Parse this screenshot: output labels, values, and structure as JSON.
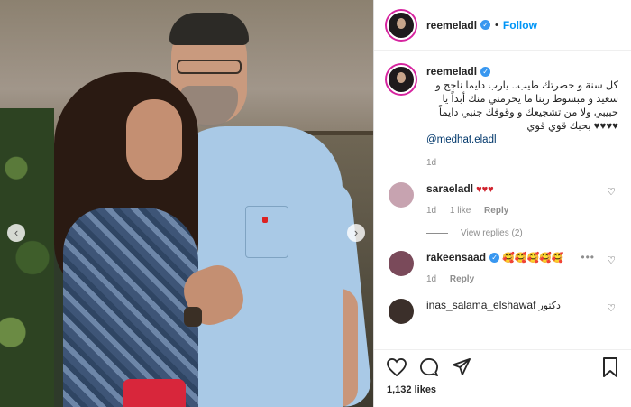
{
  "post": {
    "username": "reemeladl",
    "follow_label": "Follow",
    "dot": "•",
    "caption": {
      "text": "كل سنة و حضرتك طيب.. يارب دايما ناجح و سعيد و مبسوط ربنا ما يحرمني منك أبداً يا حبيبي ولا من تشجيعك و وقوفك جنبي دايماً ♥♥♥♥ بحبك قوي قوي",
      "mention": "@medhat.eladl",
      "time": "1d"
    },
    "comments": [
      {
        "username": "saraeladl",
        "text": "♥♥♥",
        "time": "1d",
        "likes": "1 like",
        "reply": "Reply",
        "avatar_color": "#c7a3b0"
      },
      {
        "username": "rakeensaad",
        "text": "🥰🥰🥰🥰🥰",
        "time": "1d",
        "reply": "Reply",
        "avatar_color": "#7a4a5a"
      },
      {
        "username": "inas_salama_elshawaf",
        "text": "دكتور",
        "avatar_color": "#3b2f2a"
      }
    ],
    "view_replies": "View replies (2)",
    "likes": "1,132 likes"
  },
  "icons": {
    "prev": "‹",
    "next": "›",
    "verified": "✓",
    "more": "•••",
    "heart": "♡"
  },
  "colors": {
    "accent": "#0095f6",
    "verified": "#3897f0",
    "heart_red": "#d1242f"
  }
}
